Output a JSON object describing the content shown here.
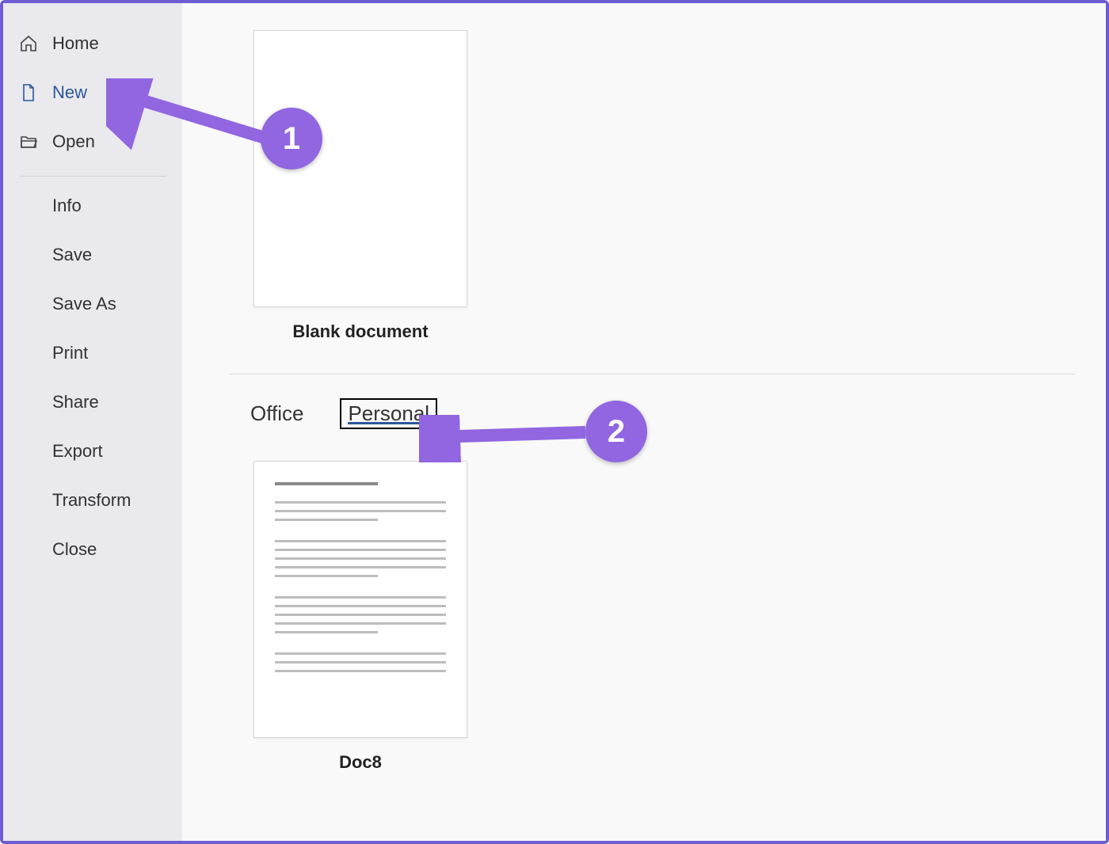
{
  "sidebar": {
    "primary": [
      {
        "label": "Home",
        "icon": "home-icon",
        "selected": false
      },
      {
        "label": "New",
        "icon": "new-doc-icon",
        "selected": true
      },
      {
        "label": "Open",
        "icon": "open-folder-icon",
        "selected": false
      }
    ],
    "secondary": [
      {
        "label": "Info"
      },
      {
        "label": "Save"
      },
      {
        "label": "Save As"
      },
      {
        "label": "Print"
      },
      {
        "label": "Share"
      },
      {
        "label": "Export"
      },
      {
        "label": "Transform"
      },
      {
        "label": "Close"
      }
    ]
  },
  "templates": {
    "blank_label": "Blank document",
    "tabs": [
      {
        "label": "Office",
        "active": false
      },
      {
        "label": "Personal",
        "active": true
      }
    ],
    "personal_items": [
      {
        "label": "Doc8"
      }
    ]
  },
  "annotations": {
    "badge1": "1",
    "badge2": "2"
  },
  "colors": {
    "accent_purple": "#9166e0",
    "frame_purple": "#6d5dd3",
    "office_blue": "#2b579a"
  }
}
